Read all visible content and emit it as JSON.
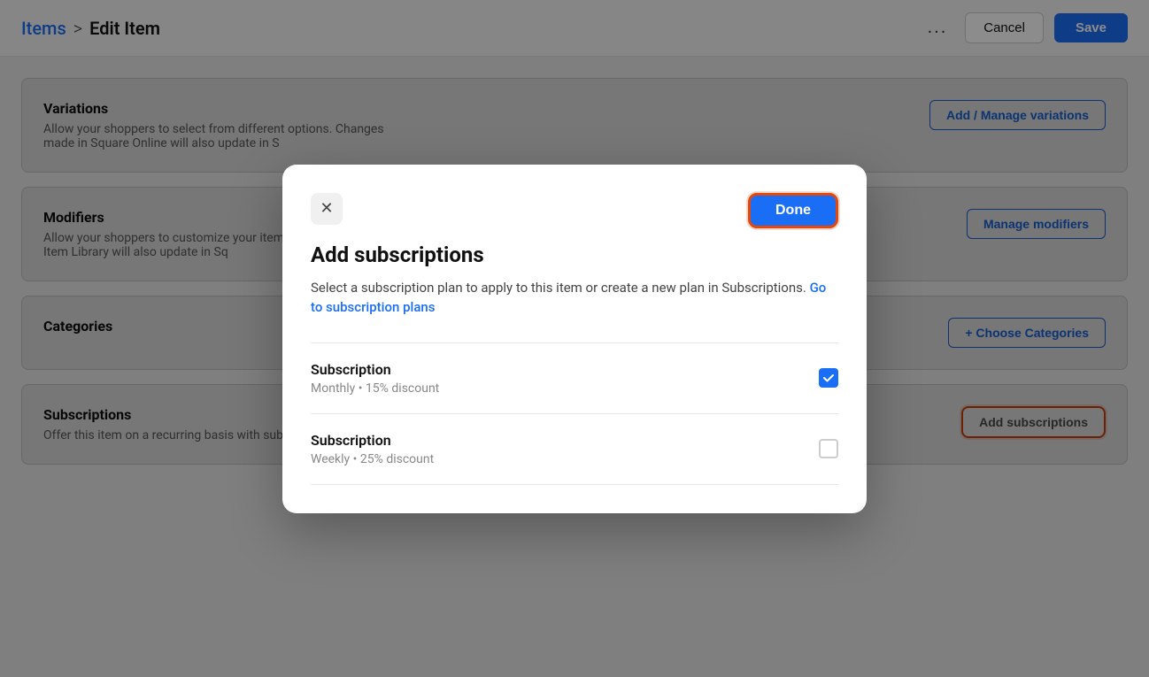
{
  "breadcrumb": {
    "items_label": "Items",
    "separator": ">",
    "current_label": "Edit Item"
  },
  "toolbar": {
    "more_label": "...",
    "cancel_label": "Cancel",
    "save_label": "Save"
  },
  "sections": {
    "variations": {
      "title": "Variations",
      "description": "Allow your shoppers to select from different options. Changes made in Square Online will also update in S",
      "action_label": "Add / Manage variations"
    },
    "modifiers": {
      "title": "Modifiers",
      "description": "Allow your shoppers to customize your item. Changes made in Item Library will also update in Sq",
      "action_label": "Manage modifiers"
    },
    "categories": {
      "title": "Categories",
      "description": "",
      "action_label": "+ Choose Categories"
    },
    "subscriptions": {
      "title": "Subscriptions",
      "description": "Offer this item on a recurring basis with subscriptions.",
      "action_label": "Add subscriptions"
    }
  },
  "modal": {
    "close_label": "✕",
    "done_label": "Done",
    "title": "Add subscriptions",
    "description_text": "Select a subscription plan to apply to this item or create a new plan in Subscriptions.",
    "description_link_text": "Go to subscription plans",
    "subscription_items": [
      {
        "id": 1,
        "title": "Subscription",
        "detail": "Monthly • 15% discount",
        "checked": true
      },
      {
        "id": 2,
        "title": "Subscription",
        "detail": "Weekly • 25% discount",
        "checked": false
      }
    ]
  },
  "colors": {
    "blue": "#1a6ef5",
    "orange": "#e8470a",
    "text_primary": "#111",
    "text_secondary": "#666"
  }
}
